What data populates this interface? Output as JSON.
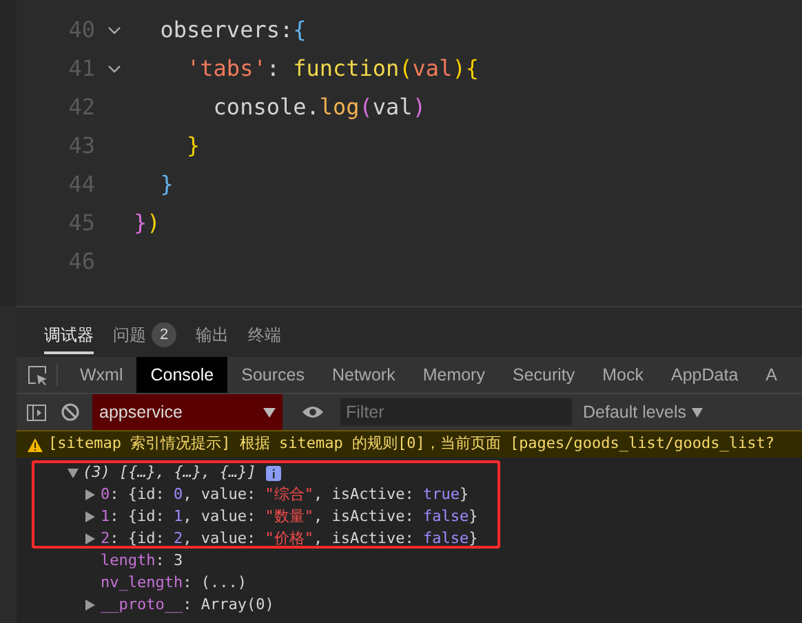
{
  "editor": {
    "lines": [
      {
        "number": "40",
        "fold": true,
        "tokens": [
          {
            "text": "  observers",
            "kind": "plain"
          },
          {
            "text": ":",
            "kind": "plain"
          },
          {
            "text": "{",
            "kind": "brace1"
          }
        ]
      },
      {
        "number": "41",
        "fold": true,
        "tokens": [
          {
            "text": "    'tabs'",
            "kind": "string"
          },
          {
            "text": ": ",
            "kind": "plain"
          },
          {
            "text": "function",
            "kind": "keyword"
          },
          {
            "text": "(",
            "kind": "brace2"
          },
          {
            "text": "val",
            "kind": "param"
          },
          {
            "text": ")",
            "kind": "brace2"
          },
          {
            "text": "{",
            "kind": "brace2"
          }
        ]
      },
      {
        "number": "42",
        "fold": false,
        "tokens": [
          {
            "text": "      console.",
            "kind": "plain"
          },
          {
            "text": "log",
            "kind": "method"
          },
          {
            "text": "(",
            "kind": "brace3"
          },
          {
            "text": "val",
            "kind": "plain"
          },
          {
            "text": ")",
            "kind": "brace3"
          }
        ]
      },
      {
        "number": "43",
        "fold": false,
        "tokens": [
          {
            "text": "    }",
            "kind": "brace2"
          }
        ]
      },
      {
        "number": "44",
        "fold": false,
        "tokens": [
          {
            "text": "  }",
            "kind": "brace1"
          }
        ]
      },
      {
        "number": "45",
        "fold": false,
        "tokens": [
          {
            "text": "}",
            "kind": "brace3"
          },
          {
            "text": ")",
            "kind": "brace2"
          }
        ]
      },
      {
        "number": "46",
        "fold": false
      }
    ]
  },
  "panel_tabs": [
    {
      "label": "调试器",
      "selected": true
    },
    {
      "label": "问题",
      "selected": false,
      "badge": "2"
    },
    {
      "label": "输出",
      "selected": false
    },
    {
      "label": "终端",
      "selected": false
    }
  ],
  "devtools_tabs": [
    {
      "label": "Wxml",
      "selected": false
    },
    {
      "label": "Console",
      "selected": true
    },
    {
      "label": "Sources",
      "selected": false
    },
    {
      "label": "Network",
      "selected": false
    },
    {
      "label": "Memory",
      "selected": false
    },
    {
      "label": "Security",
      "selected": false
    },
    {
      "label": "Mock",
      "selected": false
    },
    {
      "label": "AppData",
      "selected": false
    },
    {
      "label": "A",
      "selected": false
    }
  ],
  "console_toolbar": {
    "context": "appservice",
    "filter_placeholder": "Filter",
    "levels": "Default levels"
  },
  "warning": "[sitemap 索引情况提示] 根据 sitemap 的规则[0]，当前页面 [pages/goods_list/goods_list?",
  "output": {
    "summary": "(3) [{…}, {…}, {…}]",
    "expanded": true,
    "rows": [
      {
        "expandable": true,
        "tokens": [
          {
            "text": "0",
            "kind": "key"
          },
          {
            "text": ": {id: ",
            "kind": "plain"
          },
          {
            "text": "0",
            "kind": "number"
          },
          {
            "text": ", value: ",
            "kind": "plain"
          },
          {
            "text": "\"综合\"",
            "kind": "string"
          },
          {
            "text": ", isActive: ",
            "kind": "plain"
          },
          {
            "text": "true",
            "kind": "bool"
          },
          {
            "text": "}",
            "kind": "plain"
          }
        ]
      },
      {
        "expandable": true,
        "tokens": [
          {
            "text": "1",
            "kind": "key"
          },
          {
            "text": ": {id: ",
            "kind": "plain"
          },
          {
            "text": "1",
            "kind": "number"
          },
          {
            "text": ", value: ",
            "kind": "plain"
          },
          {
            "text": "\"数量\"",
            "kind": "string"
          },
          {
            "text": ", isActive: ",
            "kind": "plain"
          },
          {
            "text": "false",
            "kind": "bool"
          },
          {
            "text": "}",
            "kind": "plain"
          }
        ]
      },
      {
        "expandable": true,
        "tokens": [
          {
            "text": "2",
            "kind": "key"
          },
          {
            "text": ": {id: ",
            "kind": "plain"
          },
          {
            "text": "2",
            "kind": "number"
          },
          {
            "text": ", value: ",
            "kind": "plain"
          },
          {
            "text": "\"价格\"",
            "kind": "string"
          },
          {
            "text": ", isActive: ",
            "kind": "plain"
          },
          {
            "text": "false",
            "kind": "bool"
          },
          {
            "text": "}",
            "kind": "plain"
          }
        ]
      },
      {
        "expandable": false,
        "tokens": [
          {
            "text": "length",
            "kind": "key"
          },
          {
            "text": ": ",
            "kind": "plain"
          },
          {
            "text": "3",
            "kind": "plain"
          }
        ]
      },
      {
        "expandable": false,
        "tokens": [
          {
            "text": "nv_length",
            "kind": "key"
          },
          {
            "text": ": (...)",
            "kind": "plain"
          }
        ]
      },
      {
        "expandable": true,
        "tokens": [
          {
            "text": "__proto__",
            "kind": "key"
          },
          {
            "text": ": Array(0)",
            "kind": "plain"
          }
        ]
      }
    ]
  }
}
